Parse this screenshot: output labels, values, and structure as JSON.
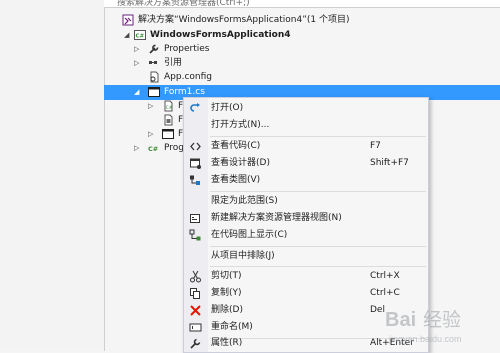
{
  "search": {
    "placeholder": "搜索解决方案资源管理器(Ctrl+;)"
  },
  "tree": {
    "solution": "解决方案“WindowsFormsApplication4”(1 个项目)",
    "project": "WindowsFormsApplication4",
    "properties": "Properties",
    "references": "引用",
    "app_config": "App.config",
    "form1": "Form1.cs",
    "child1": "Fo",
    "child2": "Fo",
    "child3": "Fo",
    "program": "Prog"
  },
  "context_menu": {
    "items": [
      {
        "label": "打开(O)",
        "shortcut": "",
        "icon": "open-icon"
      },
      {
        "label": "打开方式(N)...",
        "shortcut": "",
        "icon": ""
      },
      {
        "label": "查看代码(C)",
        "shortcut": "F7",
        "icon": "code-icon"
      },
      {
        "label": "查看设计器(D)",
        "shortcut": "Shift+F7",
        "icon": "designer-icon"
      },
      {
        "label": "查看类图(V)",
        "shortcut": "",
        "icon": "class-diagram-icon"
      },
      {
        "label": "限定为此范围(S)",
        "shortcut": "",
        "icon": ""
      },
      {
        "label": "新建解决方案资源管理器视图(N)",
        "shortcut": "",
        "icon": "new-view-icon"
      },
      {
        "label": "在代码图上显示(C)",
        "shortcut": "",
        "icon": "code-map-icon"
      },
      {
        "label": "从项目中排除(J)",
        "shortcut": "",
        "icon": ""
      },
      {
        "label": "剪切(T)",
        "shortcut": "Ctrl+X",
        "icon": "cut-icon"
      },
      {
        "label": "复制(Y)",
        "shortcut": "Ctrl+C",
        "icon": "copy-icon"
      },
      {
        "label": "删除(D)",
        "shortcut": "Del",
        "icon": "delete-icon"
      },
      {
        "label": "重命名(M)",
        "shortcut": "",
        "icon": "rename-icon"
      },
      {
        "label": "属性(R)",
        "shortcut": "Alt+Enter",
        "icon": "properties-icon"
      }
    ]
  },
  "watermark": {
    "text": "Bai经验",
    "sub": "jingyan.baidu.com"
  },
  "colors": {
    "selection": "#3399ff",
    "vs_purple": "#68217a",
    "delete_red": "#e51400"
  }
}
